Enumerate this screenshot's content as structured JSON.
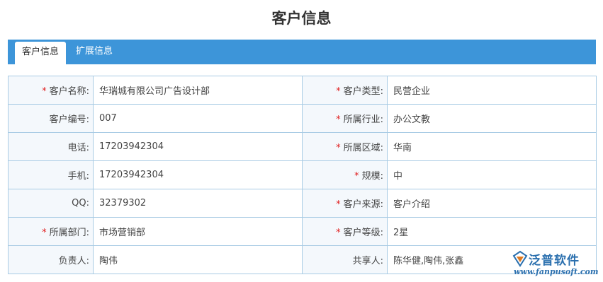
{
  "page": {
    "title": "客户信息"
  },
  "tabs": [
    {
      "label": "客户信息",
      "active": true
    },
    {
      "label": "扩展信息",
      "active": false
    }
  ],
  "form": {
    "rows": [
      {
        "left_label": "客户名称:",
        "left_required": true,
        "left_value": "华瑞城有限公司广告设计部",
        "right_label": "客户类型:",
        "right_required": true,
        "right_value": "民营企业"
      },
      {
        "left_label": "客户编号:",
        "left_required": false,
        "left_value": "007",
        "right_label": "所属行业:",
        "right_required": true,
        "right_value": "办公文教"
      },
      {
        "left_label": "电话:",
        "left_required": false,
        "left_value": "17203942304",
        "right_label": "所属区域:",
        "right_required": true,
        "right_value": "华南"
      },
      {
        "left_label": "手机:",
        "left_required": false,
        "left_value": "17203942304",
        "right_label": "规模:",
        "right_required": true,
        "right_value": "中"
      },
      {
        "left_label": "QQ:",
        "left_required": false,
        "left_value": "32379302",
        "right_label": "客户来源:",
        "right_required": true,
        "right_value": "客户介绍"
      },
      {
        "left_label": "所属部门:",
        "left_required": true,
        "left_value": "市场营销部",
        "right_label": "客户等级:",
        "right_required": true,
        "right_value": "2星"
      },
      {
        "left_label": "负责人:",
        "left_required": false,
        "left_value": "陶伟",
        "right_label": "共享人:",
        "right_required": false,
        "right_value": "陈华健,陶伟,张鑫"
      }
    ],
    "required_mark": "*"
  },
  "logo": {
    "brand": "泛普软件",
    "url": "www.fanpusoft.com"
  },
  "colors": {
    "tab_bar": "#3d95d9",
    "border": "#a8cbe4",
    "label_bg": "#f4f8fc",
    "required": "#e02020",
    "logo": "#2a6fae"
  }
}
